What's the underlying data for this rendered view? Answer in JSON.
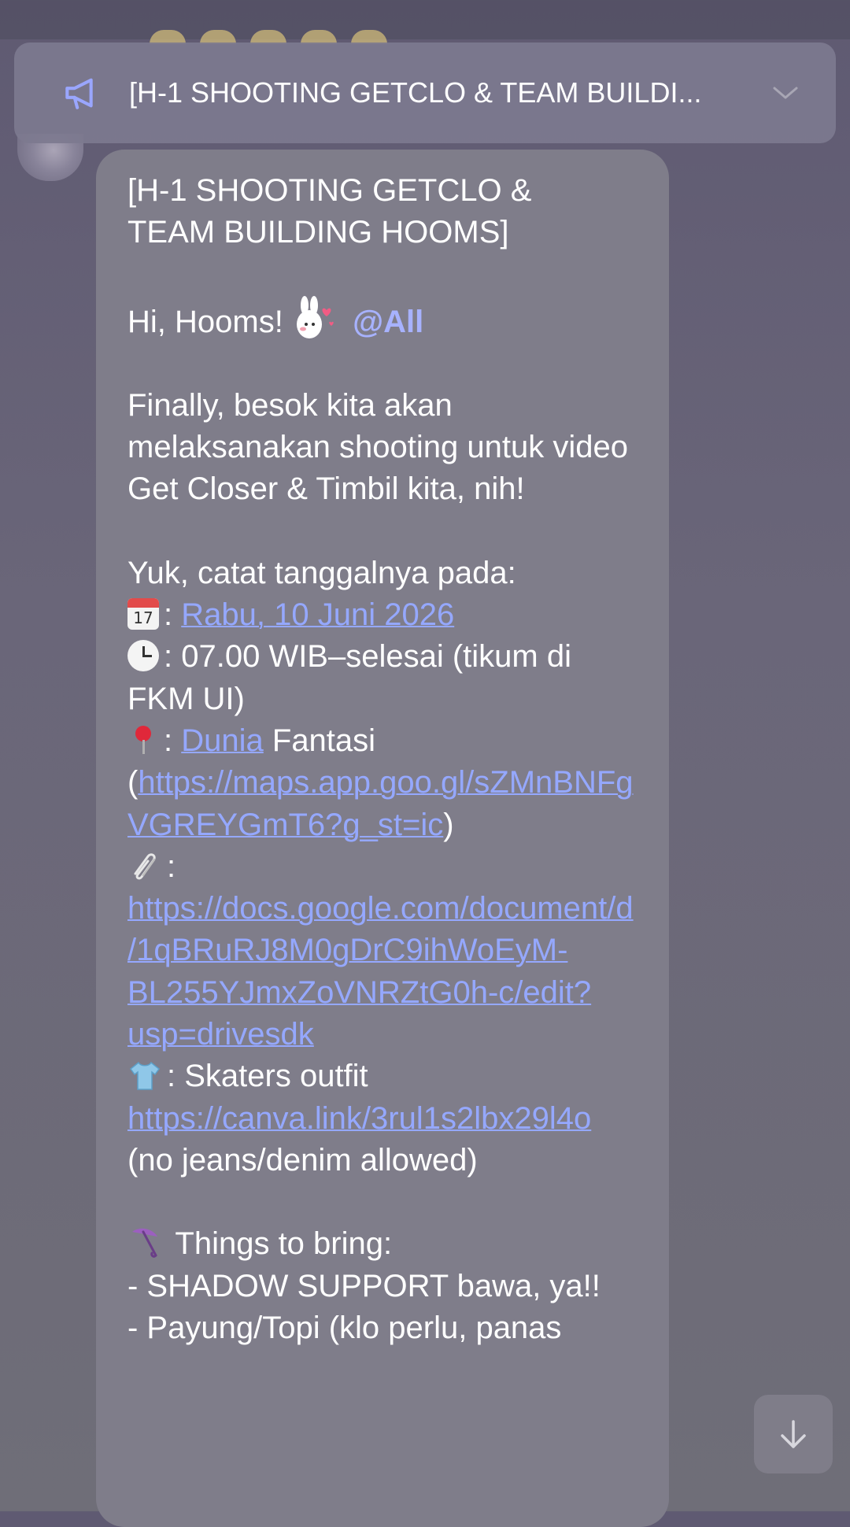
{
  "announcement": {
    "text": "[H-1 SHOOTING GETCLO & TEAM BUILDI...",
    "icon": "megaphone-icon",
    "expand_icon": "chevron-down-icon"
  },
  "message": {
    "title_line1": "[H-1 SHOOTING GETCLO &",
    "title_line2": "TEAM BUILDING HOOMS]",
    "greeting": "Hi, Hooms!",
    "mention": "@All",
    "intro": "Finally, besok kita akan melaksanakan shooting untuk video Get Closer & Timbil kita, nih!",
    "date_intro": "Yuk, catat tanggalnya pada:",
    "calendar_icon_day": "17",
    "sep": ":",
    "date_value": "Rabu, 10 Juni 2026",
    "time_value": ": 07.00 WIB–selesai (tikum di FKM UI)",
    "place_link_word": "Dunia",
    "place_rest": " Fantasi (",
    "place_maps_url": "https://maps.app.goo.gl/sZMnBNFgVGREYGmT6?g_st=ic",
    "place_close": ")",
    "doc_url": "https://docs.google.com/document/d/1qBRuRJ8M0gDrC9ihWoEyM-BL255YJmxZoVNRZtG0h-c/edit?usp=drivesdk",
    "outfit_text": ": Skaters outfit ",
    "outfit_url": "https://canva.link/3rul1s2lbx29l4o",
    "outfit_note": " (no jeans/denim allowed)",
    "bring_title": " Things to bring:",
    "bring_item1": "- SHADOW SUPPORT bawa, ya!!",
    "bring_item2": "- Payung/Topi (klo perlu, panas"
  },
  "colors": {
    "link": "#95a8ff",
    "mention": "#a7b2ff",
    "bubble": "#7f7d8a",
    "banner": "#7d798f"
  }
}
